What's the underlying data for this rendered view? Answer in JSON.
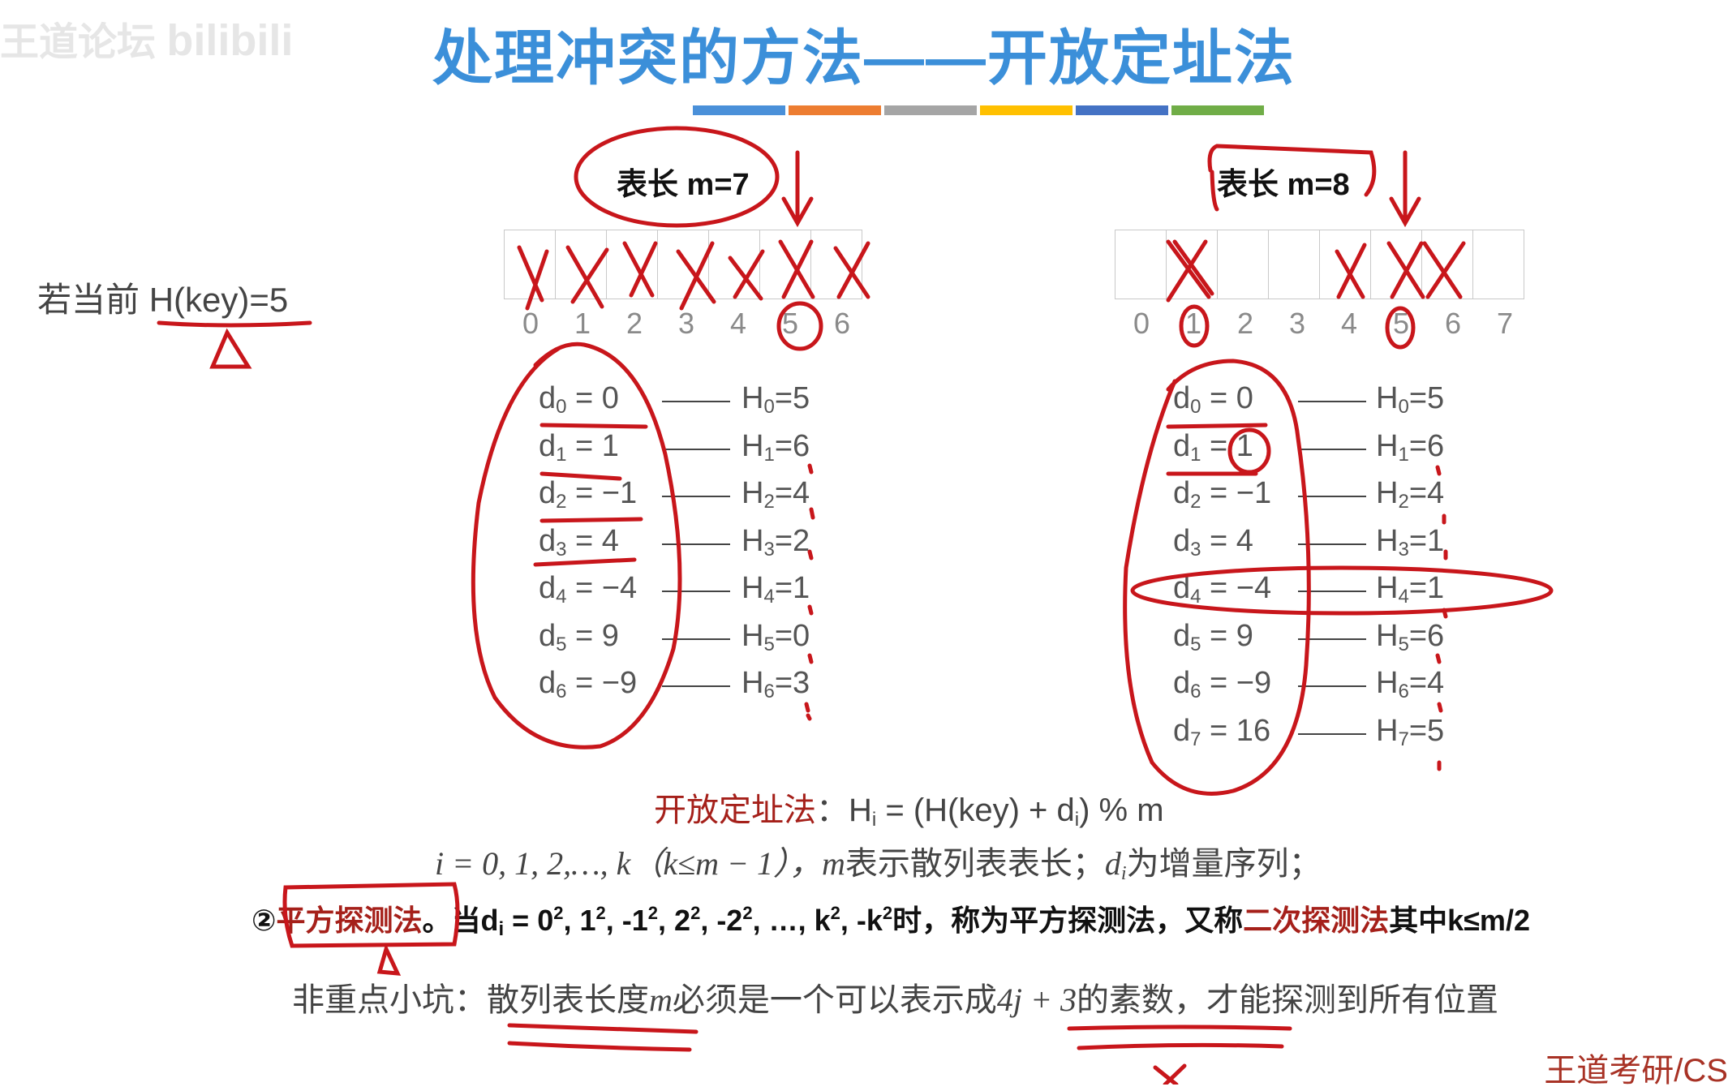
{
  "title": "处理冲突的方法——开放定址法",
  "title_bar_colors": [
    "#4a90d9",
    "#ed7d31",
    "#a5a5a5",
    "#ffc000",
    "#4472c4",
    "#70ad47"
  ],
  "watermark": "王道论坛",
  "watermark_logo": "bilibili",
  "bottom_watermark": "王道考研/CS",
  "current_hash": {
    "label": "若当前",
    "expr": "H(key)=5"
  },
  "left": {
    "table_len_label": "表长 m=7",
    "indices": [
      "0",
      "1",
      "2",
      "3",
      "4",
      "5",
      "6"
    ],
    "d_rows": [
      {
        "d": "d",
        "sub": "0",
        "val": " = 0"
      },
      {
        "d": "d",
        "sub": "1",
        "val": " = 1"
      },
      {
        "d": "d",
        "sub": "2",
        "val": " = −1"
      },
      {
        "d": "d",
        "sub": "3",
        "val": " = 4"
      },
      {
        "d": "d",
        "sub": "4",
        "val": " = −4"
      },
      {
        "d": "d",
        "sub": "5",
        "val": " = 9"
      },
      {
        "d": "d",
        "sub": "6",
        "val": " = −9"
      }
    ],
    "h_rows": [
      {
        "h": "H",
        "sub": "0",
        "val": "=5"
      },
      {
        "h": "H",
        "sub": "1",
        "val": "=6"
      },
      {
        "h": "H",
        "sub": "2",
        "val": "=4"
      },
      {
        "h": "H",
        "sub": "3",
        "val": "=2"
      },
      {
        "h": "H",
        "sub": "4",
        "val": "=1"
      },
      {
        "h": "H",
        "sub": "5",
        "val": "=0"
      },
      {
        "h": "H",
        "sub": "6",
        "val": "=3"
      }
    ]
  },
  "right": {
    "table_len_label": "表长 m=8",
    "indices": [
      "0",
      "1",
      "2",
      "3",
      "4",
      "5",
      "6",
      "7"
    ],
    "d_rows": [
      {
        "d": "d",
        "sub": "0",
        "val": " = 0"
      },
      {
        "d": "d",
        "sub": "1",
        "val": " = 1"
      },
      {
        "d": "d",
        "sub": "2",
        "val": " = −1"
      },
      {
        "d": "d",
        "sub": "3",
        "val": " = 4"
      },
      {
        "d": "d",
        "sub": "4",
        "val": " = −4"
      },
      {
        "d": "d",
        "sub": "5",
        "val": " = 9"
      },
      {
        "d": "d",
        "sub": "6",
        "val": " = −9"
      },
      {
        "d": "d",
        "sub": "7",
        "val": " = 16"
      }
    ],
    "h_rows": [
      {
        "h": "H",
        "sub": "0",
        "val": "=5"
      },
      {
        "h": "H",
        "sub": "1",
        "val": "=6"
      },
      {
        "h": "H",
        "sub": "2",
        "val": "=4"
      },
      {
        "h": "H",
        "sub": "3",
        "val": "=1"
      },
      {
        "h": "H",
        "sub": "4",
        "val": "=1"
      },
      {
        "h": "H",
        "sub": "5",
        "val": "=6"
      },
      {
        "h": "H",
        "sub": "6",
        "val": "=4"
      },
      {
        "h": "H",
        "sub": "7",
        "val": "=5"
      }
    ]
  },
  "formula": {
    "label": "开放定址法",
    "colon": "：",
    "expr_a": "H",
    "expr_sub": "i",
    "expr_b": " = (H(key) + d",
    "expr_sub2": "i",
    "expr_c": ") % m"
  },
  "range_line": {
    "a": "i = 0, 1, 2,…, k（k≤m − 1），",
    "b": "m",
    "c": "表示散列表表长；",
    "d": "d",
    "d_sub": "i",
    "e": "为增量序列；"
  },
  "quad_line": {
    "num": "②",
    "name": "平方探测法",
    "p1": "。当d",
    "p1_sub": "i",
    "p2": " = 0",
    "p3": ", 1",
    "p4": ", -1",
    "p5": ", 2",
    "p6": ", -2",
    "p7": ", …, k",
    "p8": ", -k",
    "sq": "2",
    "p9": "时，称为平方探测法，又称",
    "alt": "二次探测法",
    "p10": "其中k≤m/2"
  },
  "note_line": {
    "a": "非重点小坑：",
    "b": "散列表长度",
    "c": "m",
    "d": "必须是一个可以表示成",
    "e": "4j + 3",
    "f": "的素数，才能探测到所有位置"
  },
  "ink_color": "#c8161b"
}
